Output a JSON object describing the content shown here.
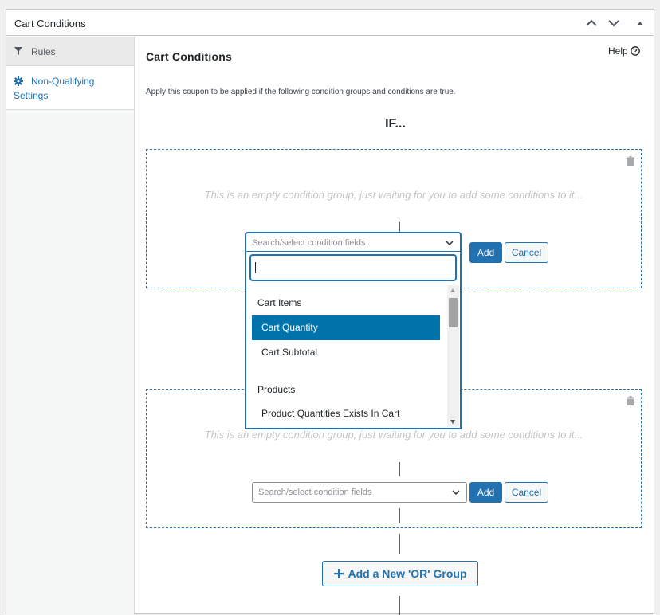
{
  "panel": {
    "title": "Cart Conditions"
  },
  "sidebar": {
    "items": [
      {
        "label": "Rules",
        "icon": "funnel-icon"
      },
      {
        "label_line1": "Non-Qualifying",
        "label_line2": "Settings",
        "icon": "gear-icon"
      }
    ]
  },
  "main": {
    "title": "Cart Conditions",
    "help": "Help",
    "description": "Apply this coupon to be applied if the following condition groups and conditions are true.",
    "if_label": "IF...",
    "groups": [
      {
        "empty_message": "This is an empty condition group, just waiting for you to add some conditions to it...",
        "select_placeholder": "Search/select condition fields",
        "add_label": "Add",
        "cancel_label": "Cancel"
      },
      {
        "empty_message": "This is an empty condition group, just waiting for you to add some conditions to it...",
        "select_placeholder": "Search/select condition fields",
        "add_label": "Add",
        "cancel_label": "Cancel"
      }
    ],
    "dropdown": {
      "search_value": "",
      "groups": [
        {
          "label": "Cart Items",
          "options": [
            "Cart Quantity",
            "Cart Subtotal"
          ],
          "highlighted": "Cart Quantity"
        },
        {
          "label": "Products",
          "options": [
            "Product Quantities Exists In Cart"
          ]
        }
      ]
    },
    "add_or_group": "Add a New 'OR' Group"
  },
  "colors": {
    "accent": "#2271b1",
    "highlight": "#0073aa",
    "border": "#c3c4c7"
  }
}
